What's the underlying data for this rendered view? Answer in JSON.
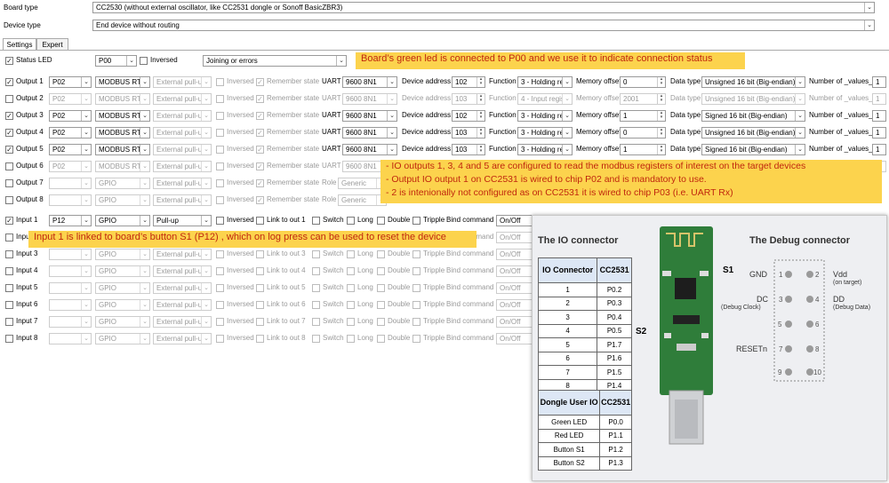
{
  "board_type": {
    "label": "Board type",
    "value": "CC2530 (without external oscillator, like CC2531 dongle or Sonoff BasicZBR3)"
  },
  "device_type": {
    "label": "Device type",
    "value": "End device without routing"
  },
  "tabs": [
    {
      "label": "Settings"
    },
    {
      "label": "Expert"
    }
  ],
  "status_led": {
    "label": "Status LED",
    "pin": "P00",
    "inversed_label": "Inversed",
    "mode": "Joining or errors"
  },
  "common": {
    "inversed": "Inversed",
    "remember_state": "Remember state",
    "uart": "UART",
    "device_address": "Device address",
    "function": "Function",
    "memory_offset": "Memory offset",
    "data_type": "Data type",
    "number_of_values": "Number of _values_",
    "role": "Role",
    "link_prefix": "Link to out ",
    "switch": "Switch",
    "long": "Long",
    "double": "Double",
    "tripple": "Tripple",
    "bind_command": "Bind command"
  },
  "outputs": [
    {
      "label": "Output 1",
      "checked": true,
      "pin": "P02",
      "mode": "MODBUS RT",
      "pull": "External pull-up",
      "uart": "9600 8N1",
      "addr": "102",
      "func": "3 - Holding reg",
      "mem": "0",
      "dtype": "Unsigned 16 bit (Big-endian)",
      "num": "1"
    },
    {
      "label": "Output 2",
      "checked": false,
      "pin": "P02",
      "mode": "MODBUS RT",
      "pull": "External pull-up",
      "uart": "9600 8N1",
      "addr": "103",
      "func": "4 - Input regist",
      "mem": "2001",
      "dtype": "Unsigned 16 bit (Big-endian)",
      "num": "1"
    },
    {
      "label": "Output 3",
      "checked": true,
      "pin": "P02",
      "mode": "MODBUS RT",
      "pull": "External pull-up",
      "uart": "9600 8N1",
      "addr": "102",
      "func": "3 - Holding reg",
      "mem": "1",
      "dtype": "Signed 16 bit (Big-endian)",
      "num": "1"
    },
    {
      "label": "Output 4",
      "checked": true,
      "pin": "P02",
      "mode": "MODBUS RT",
      "pull": "External pull-up",
      "uart": "9600 8N1",
      "addr": "103",
      "func": "3 - Holding reg",
      "mem": "0",
      "dtype": "Unsigned 16 bit (Big-endian)",
      "num": "1"
    },
    {
      "label": "Output 5",
      "checked": true,
      "pin": "P02",
      "mode": "MODBUS RT",
      "pull": "External pull-up",
      "uart": "9600 8N1",
      "addr": "103",
      "func": "3 - Holding reg",
      "mem": "1",
      "dtype": "Signed 16 bit (Big-endian)",
      "num": "1"
    },
    {
      "label": "Output 6",
      "checked": false,
      "pin": "P02",
      "mode": "MODBUS RT",
      "pull": "External pull-up",
      "uart": "9600 8N1",
      "num": "1"
    },
    {
      "label": "Output 7",
      "checked": false,
      "pin": "",
      "mode": "GPIO",
      "pull": "External pull-up",
      "role": "Generic"
    },
    {
      "label": "Output 8",
      "checked": false,
      "pin": "",
      "mode": "GPIO",
      "pull": "External pull-up",
      "role": "Generic"
    }
  ],
  "inputs": [
    {
      "label": "Input 1",
      "checked": true,
      "pin": "P12",
      "mode": "GPIO",
      "pull": "Pull-up",
      "bind": "On/Off"
    },
    {
      "label": "Input 2",
      "checked": false,
      "pin": "",
      "mode": "GPIO",
      "pull": "External pull-up",
      "bind": "On/Off"
    },
    {
      "label": "Input 3",
      "checked": false,
      "pin": "",
      "mode": "GPIO",
      "pull": "External pull-up",
      "bind": "On/Off"
    },
    {
      "label": "Input 4",
      "checked": false,
      "pin": "",
      "mode": "GPIO",
      "pull": "External pull-up",
      "bind": "On/Off"
    },
    {
      "label": "Input 5",
      "checked": false,
      "pin": "",
      "mode": "GPIO",
      "pull": "External pull-up",
      "bind": "On/Off"
    },
    {
      "label": "Input 6",
      "checked": false,
      "pin": "",
      "mode": "GPIO",
      "pull": "External pull-up",
      "bind": "On/Off"
    },
    {
      "label": "Input 7",
      "checked": false,
      "pin": "",
      "mode": "GPIO",
      "pull": "External pull-up",
      "bind": "On/Off"
    },
    {
      "label": "Input 8",
      "checked": false,
      "pin": "",
      "mode": "GPIO",
      "pull": "External pull-up",
      "bind": "On/Off"
    }
  ],
  "notes": {
    "led": "Board’s green led is connected to P00 and we use it to indicate connection status",
    "io_1": "-  IO outputs 1, 3, 4 and 5 are configured to read the modbus registers of interest on the target devices",
    "io_2": "-  Output IO output 1 on CC2531 is wired to chip P02 and is mandatory to use.",
    "io_3": "-  2 is intenionally not configured as on CC2531 it is wired to chip P03 (i.e. UART Rx)",
    "input": "Input 1 is linked to board’s button S1 (P12) , which on log press can be used to reset the device"
  },
  "io_panel": {
    "title": "The IO connector",
    "debug_title": "The Debug connector",
    "io_header": [
      "IO Connector",
      "CC2531"
    ],
    "io_rows": [
      [
        "1",
        "P0.2"
      ],
      [
        "2",
        "P0.3"
      ],
      [
        "3",
        "P0.4"
      ],
      [
        "4",
        "P0.5"
      ],
      [
        "5",
        "P1.7"
      ],
      [
        "6",
        "P1.6"
      ],
      [
        "7",
        "P1.5"
      ],
      [
        "8",
        "P1.4"
      ]
    ],
    "dongle_header": [
      "Dongle User IO",
      "CC2531"
    ],
    "dongle_rows": [
      [
        "Green LED",
        "P0.0"
      ],
      [
        "Red LED",
        "P1.1"
      ],
      [
        "Button S1",
        "P1.2"
      ],
      [
        "Button S2",
        "P1.3"
      ]
    ],
    "s1": "S1",
    "s2": "S2",
    "debug_left": [
      "GND",
      "DC",
      "(Debug Clock)",
      "RESETn"
    ],
    "debug_right": [
      "Vdd",
      "(on target)",
      "DD",
      "(Debug Data)"
    ],
    "pin_numbers": [
      "1",
      "2",
      "3",
      "4",
      "5",
      "6",
      "7",
      "8",
      "9",
      "10"
    ]
  }
}
